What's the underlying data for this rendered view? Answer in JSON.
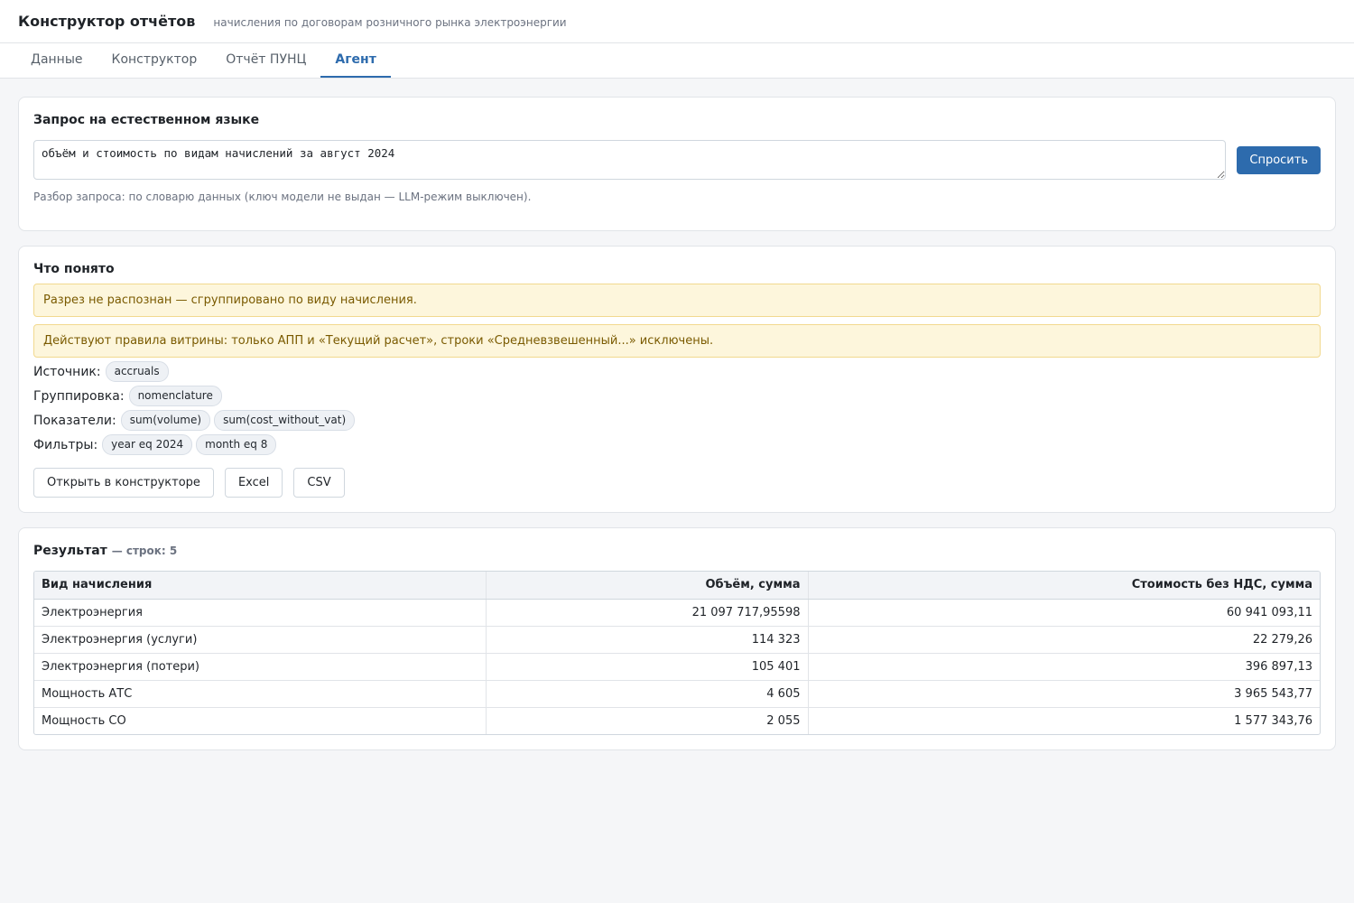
{
  "header": {
    "title": "Конструктор отчётов",
    "subtitle": "начисления по договорам розничного рынка электроэнергии"
  },
  "tabs": [
    {
      "label": "Данные",
      "active": false
    },
    {
      "label": "Конструктор",
      "active": false
    },
    {
      "label": "Отчёт ПУНЦ",
      "active": false
    },
    {
      "label": "Агент",
      "active": true
    }
  ],
  "query": {
    "title": "Запрос на естественном языке",
    "value": "объём и стоимость по видам начислений за август 2024",
    "ask_label": "Спросить",
    "hint": "Разбор запроса: по словарю данных (ключ модели не выдан — LLM-режим выключен)."
  },
  "understood": {
    "title": "Что понято",
    "warnings": [
      "Разрез не распознан — сгруппировано по виду начисления.",
      "Действуют правила витрины: только АПП и «Текущий расчет», строки «Средневзвешенный...» исключены."
    ],
    "source_label": "Источник:",
    "source": [
      "accruals"
    ],
    "grouping_label": "Группировка:",
    "grouping": [
      "nomenclature"
    ],
    "metrics_label": "Показатели:",
    "metrics": [
      "sum(volume)",
      "sum(cost_without_vat)"
    ],
    "filters_label": "Фильтры:",
    "filters": [
      "year eq 2024",
      "month eq 8"
    ],
    "buttons": {
      "open": "Открыть в конструкторе",
      "excel": "Excel",
      "csv": "CSV"
    }
  },
  "result": {
    "title": "Результат",
    "count_text": "— строк: 5",
    "columns": [
      "Вид начисления",
      "Объём, сумма",
      "Стоимость без НДС, сумма"
    ],
    "rows": [
      [
        "Электроэнергия",
        "21 097 717,95598",
        "60 941 093,11"
      ],
      [
        "Электроэнергия (услуги)",
        "114 323",
        "22 279,26"
      ],
      [
        "Электроэнергия (потери)",
        "105 401",
        "396 897,13"
      ],
      [
        "Мощность АТС",
        "4 605",
        "3 965 543,77"
      ],
      [
        "Мощность СО",
        "2 055",
        "1 577 343,76"
      ]
    ]
  }
}
